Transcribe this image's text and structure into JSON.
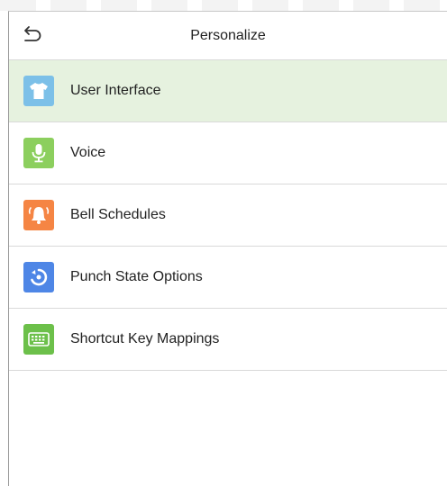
{
  "header": {
    "title": "Personalize",
    "back_icon": "back-arrow-icon"
  },
  "menu": {
    "items": [
      {
        "label": "User Interface",
        "icon": "shirt-icon",
        "color": "#7cc0e8",
        "selected": true
      },
      {
        "label": "Voice",
        "icon": "microphone-icon",
        "color": "#8ccf5e",
        "selected": false
      },
      {
        "label": "Bell Schedules",
        "icon": "bell-icon",
        "color": "#f58544",
        "selected": false
      },
      {
        "label": "Punch State Options",
        "icon": "punch-state-icon",
        "color": "#4e86e6",
        "selected": false
      },
      {
        "label": "Shortcut Key Mappings",
        "icon": "keyboard-icon",
        "color": "#6cc04a",
        "selected": false
      }
    ]
  },
  "colors": {
    "selected_background": "#e6f2df",
    "divider": "#d9d9d9"
  }
}
